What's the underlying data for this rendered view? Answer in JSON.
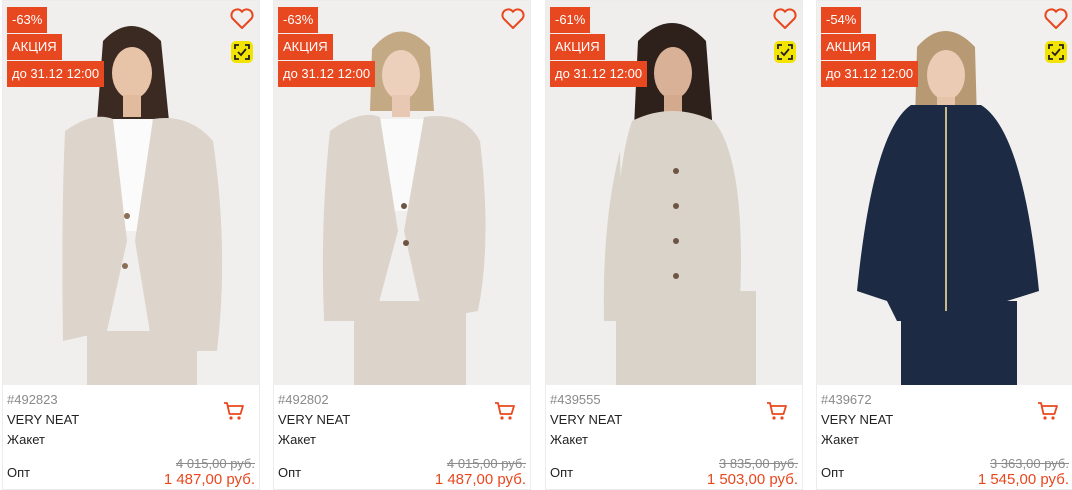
{
  "products": [
    {
      "discount": "-63%",
      "promo": "АКЦИЯ",
      "until": "до 31.12 12:00",
      "sku": "#492823",
      "brand": "VERY NEAT",
      "type": "Жакет",
      "price_label": "Опт",
      "old_price": "4 015,00 руб.",
      "new_price": "1 487,00 руб.",
      "compare_icon": true,
      "garment_color": "#ddd4cb",
      "background_color": "#f1efee"
    },
    {
      "discount": "-63%",
      "promo": "АКЦИЯ",
      "until": "до 31.12 12:00",
      "sku": "#492802",
      "brand": "VERY NEAT",
      "type": "Жакет",
      "price_label": "Опт",
      "old_price": "4 015,00 руб.",
      "new_price": "1 487,00 руб.",
      "compare_icon": false,
      "garment_color": "#dcd4ca",
      "background_color": "#f0efee"
    },
    {
      "discount": "-61%",
      "promo": "АКЦИЯ",
      "until": "до 31.12 12:00",
      "sku": "#439555",
      "brand": "VERY NEAT",
      "type": "Жакет",
      "price_label": "Опт",
      "old_price": "3 835,00 руб.",
      "new_price": "1 503,00 руб.",
      "compare_icon": true,
      "garment_color": "#d9d3c9",
      "background_color": "#efeeec"
    },
    {
      "discount": "-54%",
      "promo": "АКЦИЯ",
      "until": "до 31.12 12:00",
      "sku": "#439672",
      "brand": "VERY NEAT",
      "type": "Жакет",
      "price_label": "Опт",
      "old_price": "3 363,00 руб.",
      "new_price": "1 545,00 руб.",
      "compare_icon": true,
      "garment_color": "#1d2a44",
      "background_color": "#f1f0ef"
    }
  ],
  "colors": {
    "accent": "#e8481f",
    "compare_badge": "#f3e300",
    "muted_text": "#8a8a8a"
  },
  "icons": {
    "favorite": "heart-icon",
    "compare": "compare-icon",
    "cart": "cart-icon"
  }
}
